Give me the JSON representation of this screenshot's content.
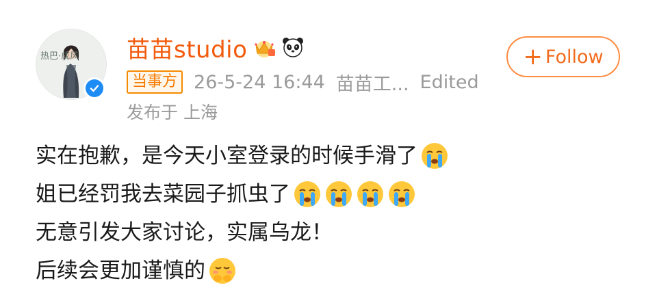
{
  "post": {
    "author": {
      "name": "苗苗studio",
      "avatar_caption": "热巴·成风",
      "verified": true,
      "badges": [
        "crown-icon",
        "panda-icon"
      ]
    },
    "tag": "当事方",
    "timestamp": "26-5-24 16:44",
    "source": "苗苗工...",
    "edited": "Edited",
    "location": "发布于 上海",
    "follow_label": "Follow",
    "lines": [
      {
        "text": "实在抱歉，是今天小室登录的时候手滑了",
        "emojis": [
          "crying-emoji"
        ]
      },
      {
        "text": "姐已经罚我去菜园子抓虫了",
        "emojis": [
          "crying-emoji",
          "crying-emoji",
          "crying-emoji",
          "crying-emoji"
        ]
      },
      {
        "text": "无意引发大家讨论，实属乌龙！",
        "emojis": []
      },
      {
        "text": "后续会更加谨慎的",
        "emojis": [
          "shy-emoji"
        ]
      }
    ]
  },
  "colors": {
    "accent": "#f25a0c",
    "meta": "#9a9a9a",
    "tag": "#f57a00",
    "verified": "#1e8cf5"
  }
}
